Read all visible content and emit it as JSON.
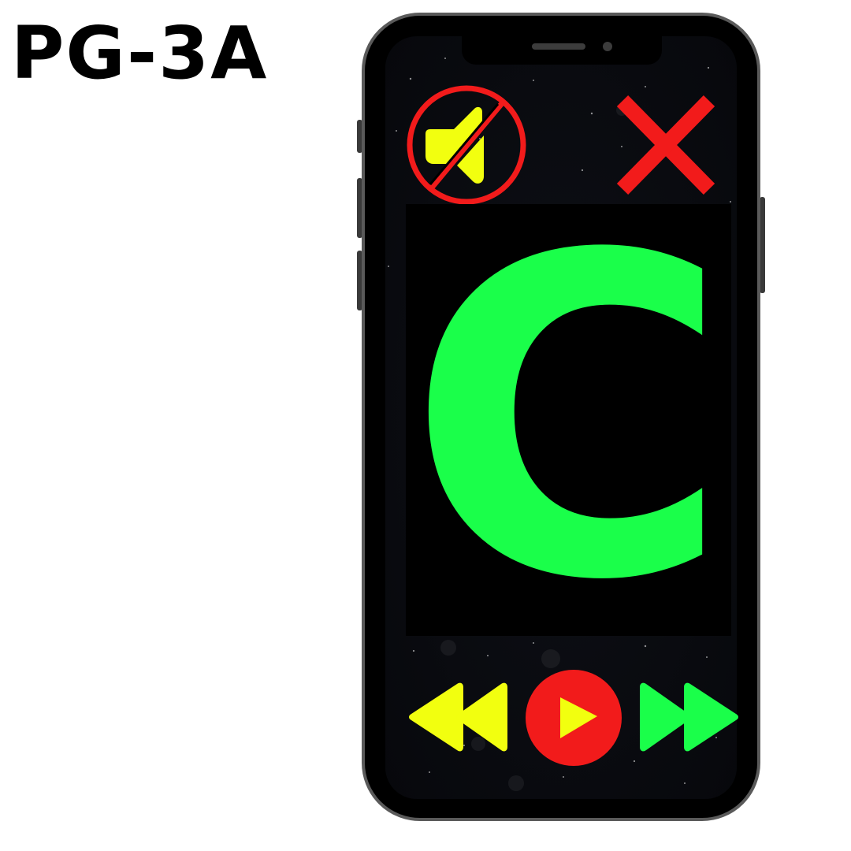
{
  "page_label": "PG-3A",
  "letter_card": {
    "letter": "C",
    "letter_color": "#1aff4a"
  },
  "toolbar": {
    "mute_icon": "speaker-muted-icon",
    "close_icon": "close-icon"
  },
  "playback": {
    "rewind_icon": "rewind-icon",
    "play_icon": "play-icon",
    "forward_icon": "fast-forward-icon"
  },
  "colors": {
    "accent_yellow": "#f2ff0f",
    "accent_red": "#f21b1b",
    "accent_green": "#1aff4a",
    "screen_bg": "#07080c",
    "phone_frame": "#5a5a5a"
  }
}
